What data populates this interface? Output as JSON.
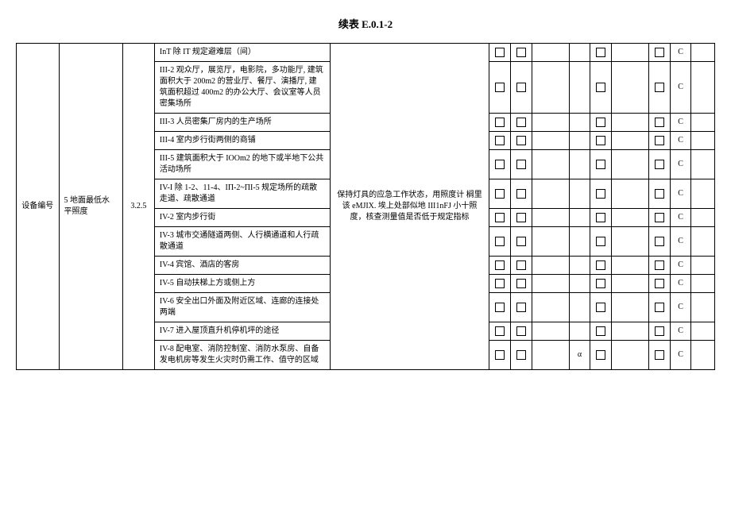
{
  "title": "续表 E.0.1-2",
  "headers": {
    "col1": "设备编号",
    "col2": "5 地面最低水平照度",
    "col3": "3.2.5",
    "col5": "保持灯具的应急工作状态，用照度计 榈里该 eMJIX. 埃上处部似地 III1nFJ 小十照度，核查测量值是否低于规定指标"
  },
  "rows": [
    {
      "desc": "InT 除 IT 规定避难层（间）",
      "alpha": "",
      "grade": "C"
    },
    {
      "desc": "III-2 观众厅，展览厅，电影院，多功能厅, 建筑面积大于 200m2 的营业厅、餐厅、演播厅, 建筑面积超过 400m2 的办公大厅、会议室等人员密集场所",
      "alpha": "",
      "grade": "C"
    },
    {
      "desc": "III-3 人员密集厂房内的生产场所",
      "alpha": "",
      "grade": "C"
    },
    {
      "desc": "III-4 室内步行街两侧的商铺",
      "alpha": "",
      "grade": "C"
    },
    {
      "desc": "III-5 建筑面积大于 IOOm2 的地下或半地下公共活动场所",
      "alpha": "",
      "grade": "C"
    },
    {
      "desc": "IV-I 除 1-2、11-4、IΠ-2~ΠI-5 规定场所的疏散走道、疏散通道",
      "alpha": "",
      "grade": "C"
    },
    {
      "desc": "IV-2 室内步行街",
      "alpha": "",
      "grade": "C"
    },
    {
      "desc": "IV-3 城市交通隧道两侧、人行横通道和人行疏散通道",
      "alpha": "",
      "grade": "C"
    },
    {
      "desc": "IV-4 宾馆、酒店的客房",
      "alpha": "",
      "grade": "C"
    },
    {
      "desc": "IV-5 自动扶梯上方或侧上方",
      "alpha": "",
      "grade": "C"
    },
    {
      "desc": "IV-6 安全出口外面及附近区域、连廊的连接处两端",
      "alpha": "",
      "grade": "C"
    },
    {
      "desc": "IV-7 进入屋顶直升机停机坪的途径",
      "alpha": "",
      "grade": "C"
    },
    {
      "desc": "IV-8 配电室、消防控制室、消防水泵房、自备发电机房等发生火灾时仍需工作、值守的区域",
      "alpha": "α",
      "grade": "C"
    }
  ]
}
